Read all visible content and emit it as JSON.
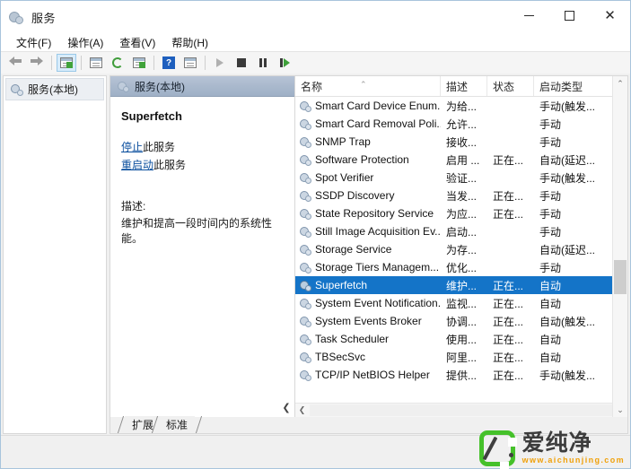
{
  "window": {
    "title": "服务",
    "title_icon": "services-gear-icon",
    "minimize_label": "最小化",
    "maximize_label": "最大化",
    "close_label": "关闭"
  },
  "menubar": {
    "items": [
      {
        "label": "文件(F)",
        "name": "menu-file"
      },
      {
        "label": "操作(A)",
        "name": "menu-action"
      },
      {
        "label": "查看(V)",
        "name": "menu-view"
      },
      {
        "label": "帮助(H)",
        "name": "menu-help"
      }
    ]
  },
  "toolbar": {
    "buttons": [
      {
        "name": "back-button",
        "icon": "arrow-left-icon"
      },
      {
        "name": "forward-button",
        "icon": "arrow-right-icon"
      },
      {
        "name": "show-hide-console-tree-button",
        "icon": "console-tree-icon",
        "selected": true
      },
      {
        "name": "properties-button",
        "icon": "properties-icon"
      },
      {
        "name": "refresh-button",
        "icon": "refresh-icon"
      },
      {
        "name": "export-list-button",
        "icon": "export-icon"
      },
      {
        "name": "help-button",
        "icon": "help-icon"
      },
      {
        "name": "show-hide-action-pane-button",
        "icon": "action-pane-icon"
      },
      {
        "name": "start-service-button",
        "icon": "play-icon"
      },
      {
        "name": "stop-service-button",
        "icon": "stop-icon"
      },
      {
        "name": "pause-service-button",
        "icon": "pause-icon"
      },
      {
        "name": "restart-service-button",
        "icon": "restart-icon"
      }
    ]
  },
  "tree": {
    "root": {
      "label": "服务(本地)",
      "icon": "services-gear-icon",
      "selected": true
    }
  },
  "detail": {
    "header": "服务(本地)",
    "header_icon": "services-gear-icon",
    "service_name": "Superfetch",
    "links": [
      {
        "link_text": "停止",
        "suffix": "此服务",
        "name": "stop-service-link"
      },
      {
        "link_text": "重启动",
        "suffix": "此服务",
        "name": "restart-service-link"
      }
    ],
    "description_label": "描述:",
    "description_text": "维护和提高一段时间内的系统性能。",
    "collapse_glyph": "❮"
  },
  "list": {
    "columns": [
      {
        "label": "名称",
        "name": "column-name",
        "sorted": true,
        "sort_glyph": "⌃"
      },
      {
        "label": "描述",
        "name": "column-description"
      },
      {
        "label": "状态",
        "name": "column-status"
      },
      {
        "label": "启动类型",
        "name": "column-startup-type"
      }
    ],
    "rows": [
      {
        "name": "Smart Card Device Enum...",
        "desc": "为给...",
        "status": "",
        "startup": "手动(触发..."
      },
      {
        "name": "Smart Card Removal Poli...",
        "desc": "允许...",
        "status": "",
        "startup": "手动"
      },
      {
        "name": "SNMP Trap",
        "desc": "接收...",
        "status": "",
        "startup": "手动"
      },
      {
        "name": "Software Protection",
        "desc": "启用 ...",
        "status": "正在...",
        "startup": "自动(延迟..."
      },
      {
        "name": "Spot Verifier",
        "desc": "验证...",
        "status": "",
        "startup": "手动(触发..."
      },
      {
        "name": "SSDP Discovery",
        "desc": "当发...",
        "status": "正在...",
        "startup": "手动"
      },
      {
        "name": "State Repository Service",
        "desc": "为应...",
        "status": "正在...",
        "startup": "手动"
      },
      {
        "name": "Still Image Acquisition Ev...",
        "desc": "启动...",
        "status": "",
        "startup": "手动"
      },
      {
        "name": "Storage Service",
        "desc": "为存...",
        "status": "",
        "startup": "自动(延迟..."
      },
      {
        "name": "Storage Tiers Managem...",
        "desc": "优化...",
        "status": "",
        "startup": "手动"
      },
      {
        "name": "Superfetch",
        "desc": "维护...",
        "status": "正在...",
        "startup": "自动",
        "selected": true
      },
      {
        "name": "System Event Notification...",
        "desc": "监视...",
        "status": "正在...",
        "startup": "自动"
      },
      {
        "name": "System Events Broker",
        "desc": "协调...",
        "status": "正在...",
        "startup": "自动(触发..."
      },
      {
        "name": "Task Scheduler",
        "desc": "使用...",
        "status": "正在...",
        "startup": "自动"
      },
      {
        "name": "TBSecSvc",
        "desc": "阿里...",
        "status": "正在...",
        "startup": "自动"
      },
      {
        "name": "TCP/IP NetBIOS Helper",
        "desc": "提供...",
        "status": "正在...",
        "startup": "手动(触发..."
      }
    ],
    "scroll_up_glyph": "⌃",
    "scroll_down_glyph": "⌄",
    "hscroll_left_glyph": "❮"
  },
  "tabs": [
    {
      "label": "扩展",
      "name": "tab-extended"
    },
    {
      "label": "标准",
      "name": "tab-standard",
      "active": true
    }
  ],
  "watermark": {
    "brand": "爱纯净",
    "url": "www.aichunjing.com"
  },
  "colors": {
    "selection_blue": "#1474c8",
    "link_blue": "#0b4f9e",
    "logo_green": "#45c12a",
    "url_orange": "#f0a10a",
    "titlebar_border": "#a8c4dc"
  }
}
